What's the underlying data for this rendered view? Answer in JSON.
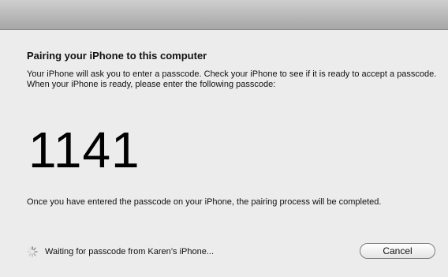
{
  "dialog": {
    "heading": "Pairing your iPhone to this computer",
    "message": "Your iPhone will ask you to enter a passcode. Check your iPhone to see if it is ready to accept a passcode. When your iPhone is ready, please enter the following passcode:",
    "passcode": "1141",
    "completion_message": "Once you have entered the passcode on your iPhone, the pairing process will be completed.",
    "status_text": "Waiting for passcode from Karen’s iPhone...",
    "status_icon": "spinner-icon",
    "cancel_label": "Cancel"
  }
}
